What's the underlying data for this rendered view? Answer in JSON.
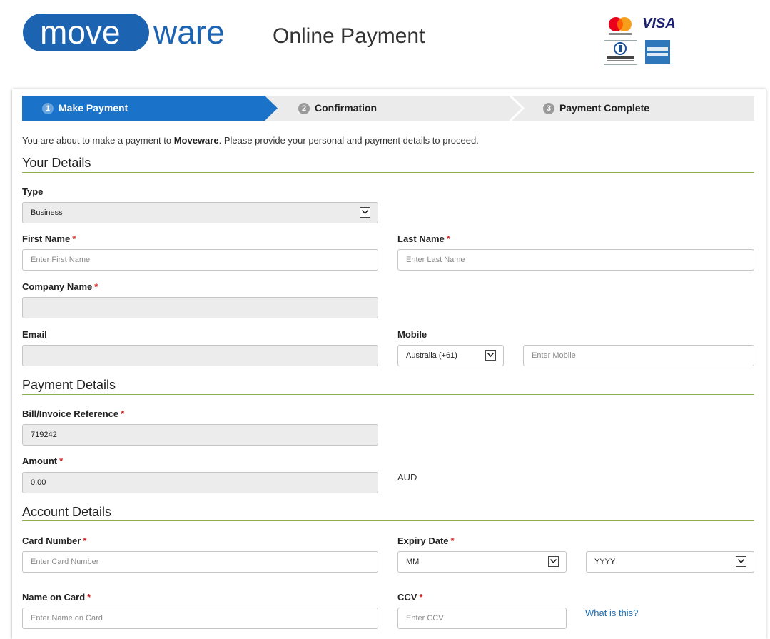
{
  "header": {
    "logo_part1": "move",
    "logo_part2": "ware",
    "title": "Online Payment",
    "cards": {
      "visa": "VISA",
      "mastercard": "mastercard",
      "diners": "Diners Club",
      "amex": "AMERICAN EXPRESS"
    }
  },
  "steps": [
    {
      "num": "1",
      "label": "Make Payment"
    },
    {
      "num": "2",
      "label": "Confirmation"
    },
    {
      "num": "3",
      "label": "Payment Complete"
    }
  ],
  "intro": {
    "prefix": "You are about to make a payment to ",
    "company": "Moveware",
    "suffix": ". Please provide your personal and payment details to proceed."
  },
  "sections": {
    "your_details": "Your Details",
    "payment_details": "Payment Details",
    "account_details": "Account Details"
  },
  "fields": {
    "type": {
      "label": "Type",
      "value": "Business"
    },
    "first_name": {
      "label": "First Name",
      "placeholder": "Enter First Name"
    },
    "last_name": {
      "label": "Last Name",
      "placeholder": "Enter Last Name"
    },
    "company_name": {
      "label": "Company Name",
      "value": ""
    },
    "email": {
      "label": "Email",
      "value": ""
    },
    "mobile": {
      "label": "Mobile",
      "country": "Australia (+61)",
      "placeholder": "Enter Mobile"
    },
    "bill_ref": {
      "label": "Bill/Invoice Reference",
      "value": "719242"
    },
    "amount": {
      "label": "Amount",
      "value": "0.00",
      "currency": "AUD"
    },
    "card_number": {
      "label": "Card Number",
      "placeholder": "Enter Card Number"
    },
    "expiry": {
      "label": "Expiry Date",
      "month": "MM",
      "year": "YYYY"
    },
    "name_on_card": {
      "label": "Name on Card",
      "placeholder": "Enter Name on Card"
    },
    "ccv": {
      "label": "CCV",
      "placeholder": "Enter CCV",
      "help_link": "What is this?"
    }
  },
  "required_marker": "*",
  "colors": {
    "brand_blue": "#1c64b2",
    "active_step": "#1a73c8",
    "section_rule": "#8db04f",
    "required": "#cc2222",
    "link": "#1f6fb3"
  }
}
